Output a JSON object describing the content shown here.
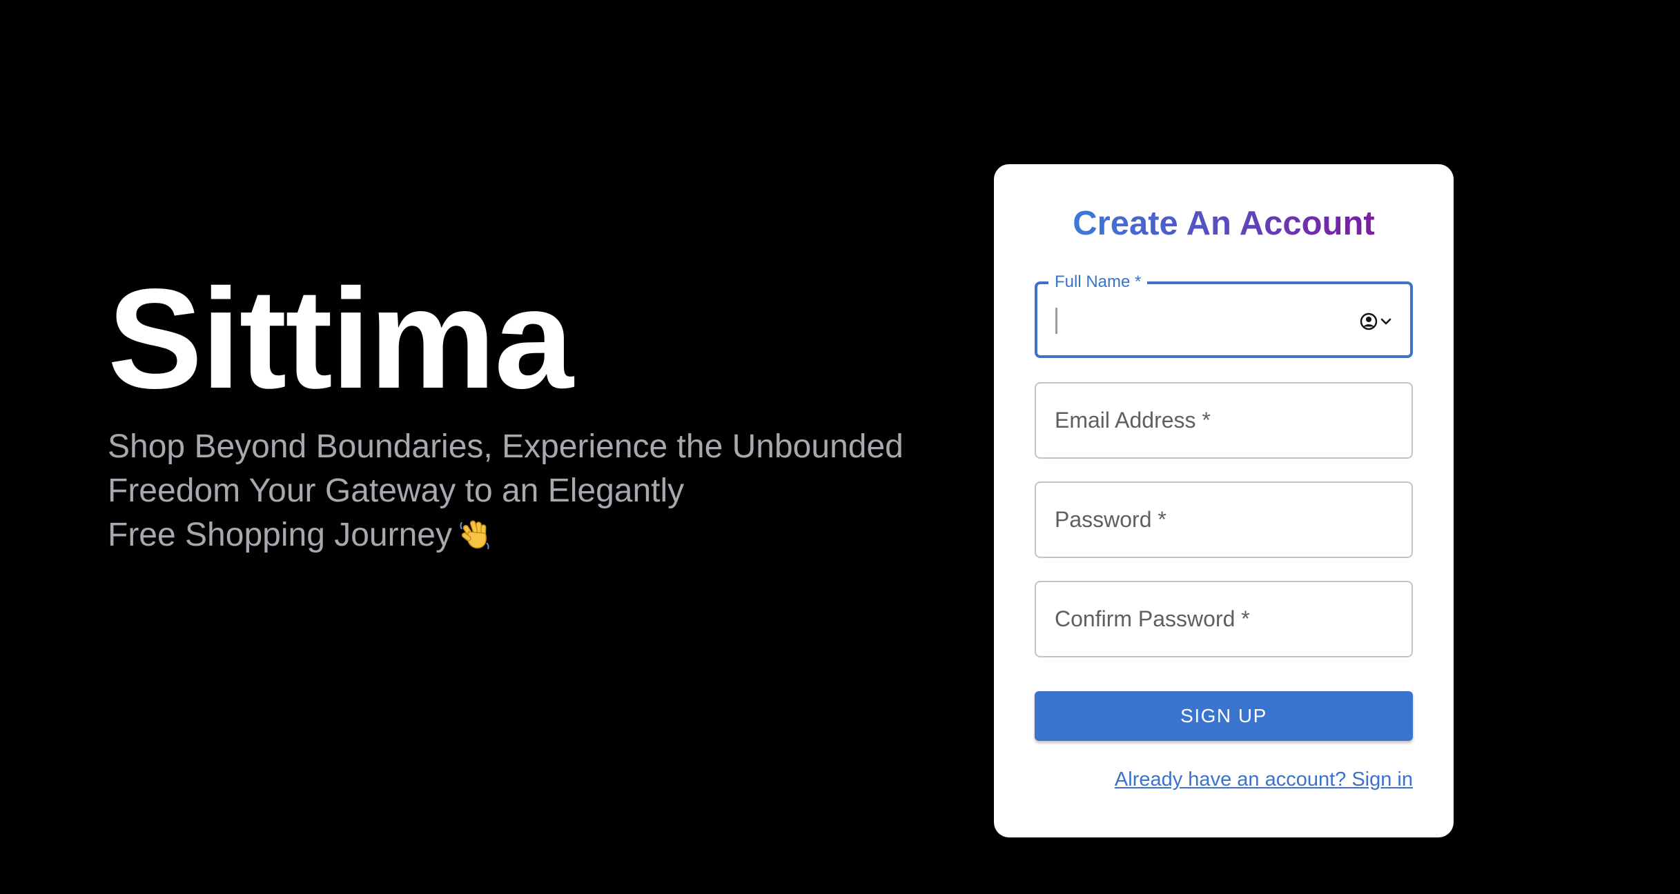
{
  "hero": {
    "brand": "Sittima",
    "tagline_lines": [
      "Shop Beyond Boundaries, Experience the Unbounded",
      "Freedom Your Gateway to an Elegantly",
      "Free Shopping Journey"
    ],
    "tagline_emoji_icon": "waving-hand-icon"
  },
  "form": {
    "title": "Create An Account",
    "fields": [
      {
        "label": "Full Name",
        "required_mark": "*",
        "value": "",
        "state": "focused",
        "autofill_icon": "person-circle-icon"
      },
      {
        "label": "Email Address",
        "required_mark": "*",
        "value": ""
      },
      {
        "label": "Password",
        "required_mark": "*",
        "value": ""
      },
      {
        "label": "Confirm Password",
        "required_mark": "*",
        "value": ""
      }
    ],
    "submit_label": "SIGN UP",
    "signin_link": "Already have an account? Sign in"
  },
  "colors": {
    "background": "#000000",
    "card": "#ffffff",
    "accent_blue": "#3a72cc",
    "title_gradient_start": "#3b78d8",
    "title_gradient_end": "#7a1fa2",
    "tagline": "#a8a8b0"
  }
}
